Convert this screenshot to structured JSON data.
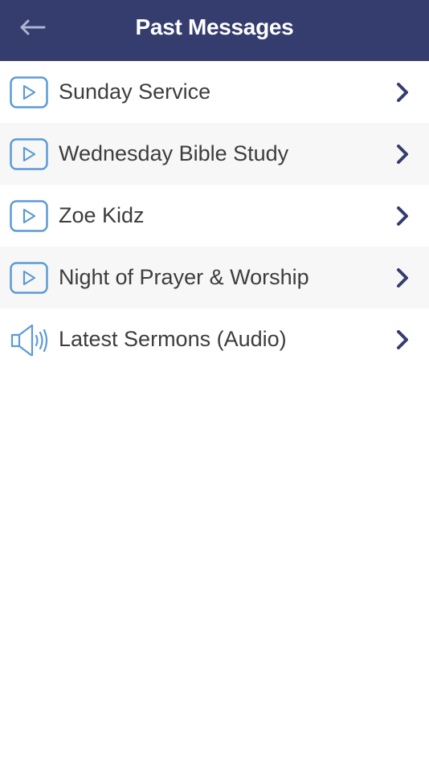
{
  "header": {
    "title": "Past Messages",
    "back_icon": "arrow-left-icon",
    "background": "#343d6e"
  },
  "list": {
    "items": [
      {
        "label": "Sunday Service",
        "icon": "play-icon"
      },
      {
        "label": "Wednesday Bible Study",
        "icon": "play-icon"
      },
      {
        "label": "Zoe Kidz",
        "icon": "play-icon"
      },
      {
        "label": "Night of Prayer & Worship",
        "icon": "play-icon"
      },
      {
        "label": "Latest Sermons (Audio)",
        "icon": "speaker-icon"
      }
    ],
    "chevron_icon": "chevron-right-icon",
    "icon_color": "#5b9bd5",
    "chevron_color": "#343d6e"
  }
}
